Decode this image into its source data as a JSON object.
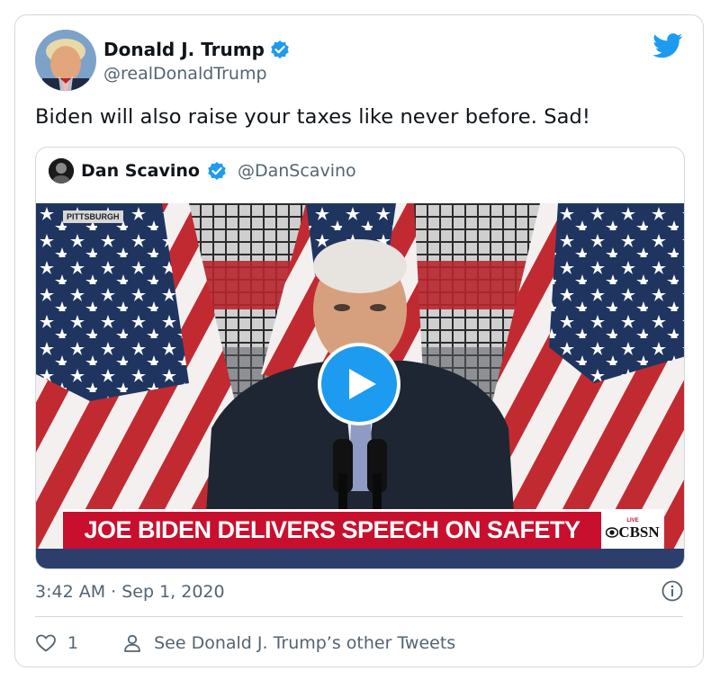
{
  "tweet": {
    "author_name": "Donald J. Trump",
    "author_handle": "@realDonaldTrump",
    "text": "Biden will also raise your taxes like never before. Sad!",
    "timestamp": "3:42 AM · Sep 1, 2020",
    "likes": "1",
    "other_tweets_label": "See Donald J. Trump’s other Tweets"
  },
  "quote": {
    "author_name": "Dan Scavino",
    "author_handle": "@DanScavino",
    "video": {
      "location_tag": "PITTSBURGH",
      "chyron": "JOE BIDEN DELIVERS SPEECH ON SAFETY",
      "network_live": "LIVE",
      "network_name": "CBSN"
    }
  },
  "colors": {
    "accent": "#1d9bf0",
    "text_primary": "#0f1419",
    "text_secondary": "#536471",
    "border": "#cfd9de",
    "chyron_red": "#c8102e"
  },
  "icons": {
    "verified": "verified-badge-icon",
    "brand": "twitter-bird-icon",
    "play": "play-icon",
    "info": "info-icon",
    "like": "heart-icon",
    "profile": "person-icon"
  }
}
